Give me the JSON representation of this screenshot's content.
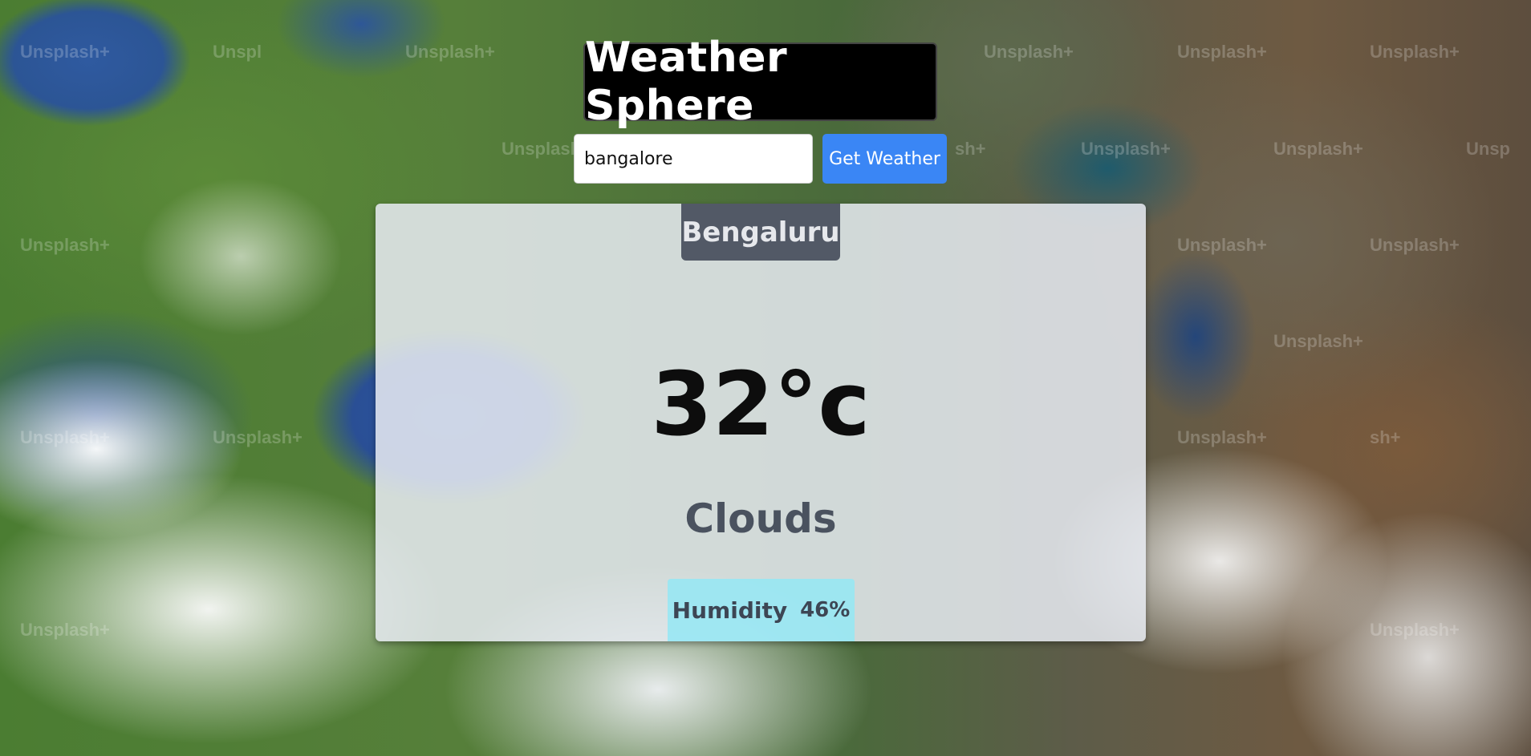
{
  "header": {
    "title": "Weather Sphere"
  },
  "search": {
    "value": "bangalore",
    "button_label": "Get Weather"
  },
  "weather": {
    "city": "Bengaluru",
    "temperature": "32°c",
    "condition": "Clouds",
    "humidity_label": "Humidity",
    "humidity_value": "46%"
  },
  "background": {
    "watermark": "Unsplash+",
    "watermark_partial": [
      "Unsplash+",
      "Unspl",
      "Unsplash+",
      "Unsplash+",
      "Unsplash+",
      "Unsplash+",
      "Unsplash+",
      "sh+",
      "Unsplash+",
      "Unsplash+",
      "Unsp",
      "Unsplash+",
      "Unsplash+",
      "Unsplash+",
      "Unsplash+",
      "Unsplash+",
      "Unsplash+",
      "Unsplash+",
      "sh+",
      "Unsplash+",
      "Unsplash+",
      "Unsplash+",
      "Unsplash+",
      "Unsplash+",
      "Unsplash+",
      "Unsplash+"
    ]
  },
  "colors": {
    "button": "#3a86f5",
    "title_bg": "#000000",
    "humidity_bg": "#94e8f5"
  }
}
